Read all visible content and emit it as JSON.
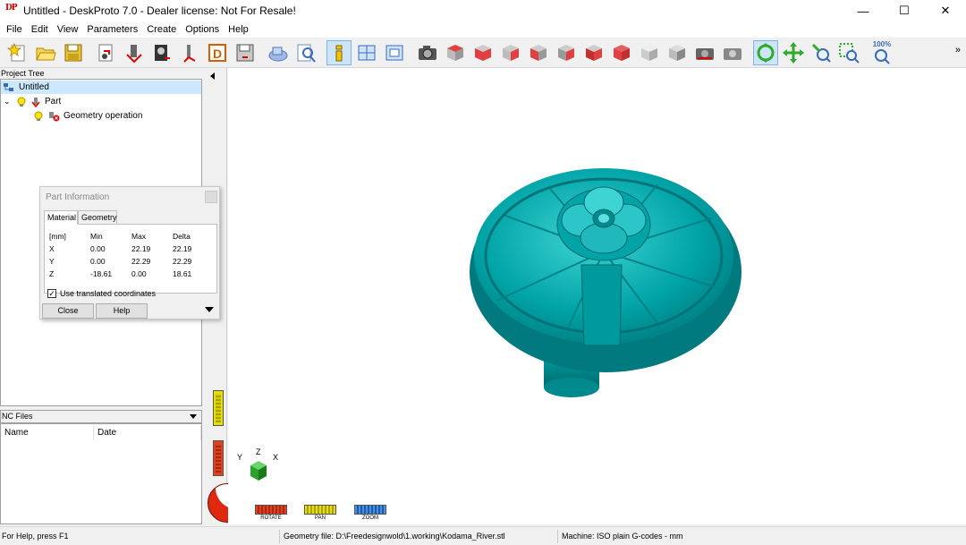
{
  "window": {
    "title": "Untitled - DeskProto 7.0 - Dealer license: Not For Resale!",
    "minimize_glyph": "—",
    "maximize_glyph": "☐",
    "close_glyph": "✕"
  },
  "menu": [
    "File",
    "Edit",
    "View",
    "Parameters",
    "Create",
    "Options",
    "Help"
  ],
  "toolbar": {
    "zoom_label": "100%",
    "overflow_glyph": "»",
    "accent_color": "#00a0a0"
  },
  "project_tree": {
    "header": "Project Tree",
    "root": "Untitled",
    "part": "Part",
    "operation": "Geometry operation"
  },
  "part_info": {
    "title": "Part Information",
    "tabs": [
      "Material",
      "Geometry"
    ],
    "columns": [
      "[mm]",
      "Min",
      "Max",
      "Delta"
    ],
    "rows": [
      {
        "axis": "X",
        "min": "0.00",
        "max": "22.19",
        "delta": "22.19"
      },
      {
        "axis": "Y",
        "min": "0.00",
        "max": "22.29",
        "delta": "22.29"
      },
      {
        "axis": "Z",
        "min": "-18.61",
        "max": "0.00",
        "delta": "18.61"
      }
    ],
    "checkbox_label": "Use translated coordinates",
    "checkbox_checked": true,
    "close_label": "Close",
    "help_label": "Help"
  },
  "nc_files": {
    "header": "NC Files",
    "col_name": "Name",
    "col_date": "Date"
  },
  "viewport": {
    "axis_y": "Y",
    "axis_z": "Z",
    "axis_x": "X",
    "rotate_label": "ROTATE",
    "pan_label": "PAN",
    "zoom_label": "ZOOM",
    "model_color": "#00a3a6"
  },
  "status": {
    "help": "For Help, press F1",
    "geometry": "Geometry file: D:\\Freedesignwold\\1.working\\Kodama_River.stl",
    "machine": "Machine: ISO plain G-codes - mm"
  }
}
